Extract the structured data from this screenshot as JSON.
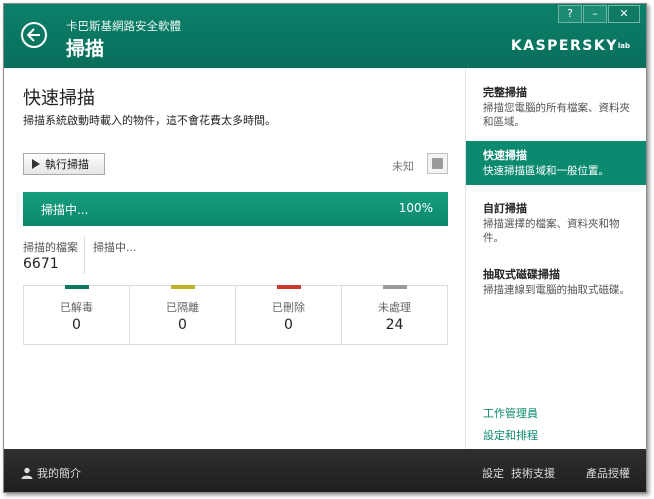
{
  "header": {
    "subtitle": "卡巴斯基網路安全軟體",
    "title": "掃描",
    "logo": "KASPERSKY",
    "logo_suffix": "lab",
    "help_label": "?",
    "minimize_label": "–",
    "close_label": "✕"
  },
  "main": {
    "title": "快速掃描",
    "description": "掃描系統啟動時載入的物件，這不會花費太多時間。",
    "run_button": "執行掃描",
    "unknown_label": "未知",
    "progress": {
      "text": "掃描中...",
      "percent_label": "100%",
      "value": 100
    },
    "files_label": "掃描的檔案",
    "scanning_label": "掃描中...",
    "files_count": "6671",
    "stats": [
      {
        "label": "已解毒",
        "value": "0",
        "color": "#0c7a5e"
      },
      {
        "label": "已隔離",
        "value": "0",
        "color": "#bcb42c"
      },
      {
        "label": "已刪除",
        "value": "0",
        "color": "#c83b2c"
      },
      {
        "label": "未處理",
        "value": "24",
        "color": "#9a9a9a"
      }
    ]
  },
  "sidebar": {
    "items": [
      {
        "title": "完整掃描",
        "desc": "掃描您電腦的所有檔案、資料夾和區域。"
      },
      {
        "title": "快速掃描",
        "desc": "快速掃描區域和一般位置。"
      },
      {
        "title": "自訂掃描",
        "desc": "掃描選擇的檔案、資料夾和物件。"
      },
      {
        "title": "抽取式磁碟掃描",
        "desc": "掃描連線到電腦的抽取式磁碟。"
      }
    ],
    "task_manager": "工作管理員",
    "settings_schedule": "設定和排程"
  },
  "footer": {
    "profile": "我的簡介",
    "settings": "設定",
    "support": "技術支援",
    "licensing": "產品授權"
  },
  "colors": {
    "brand": "#0c8a70"
  }
}
